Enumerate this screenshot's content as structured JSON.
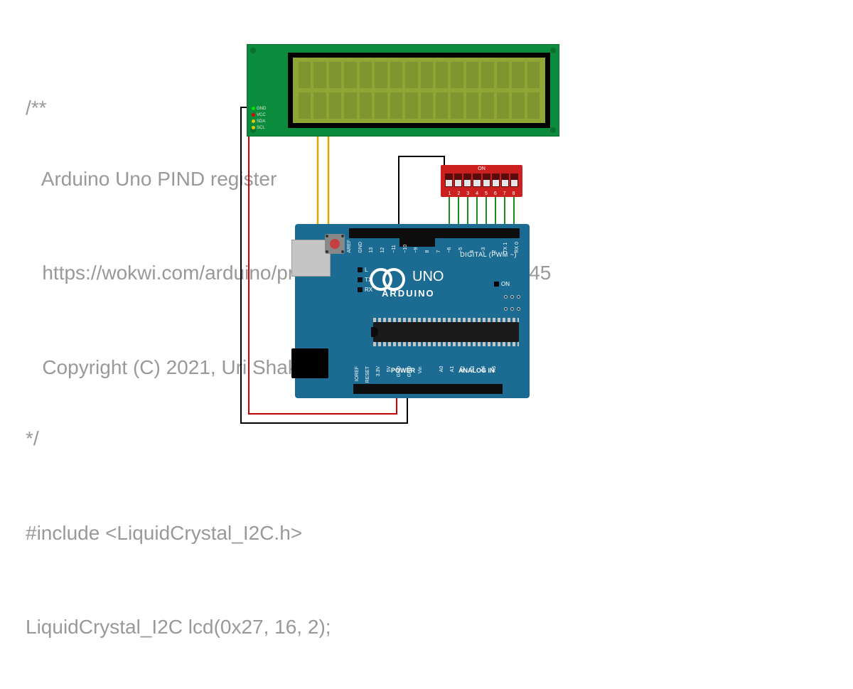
{
  "code": {
    "line1": "/**",
    "line2": "   Arduino Uno PIND register",
    "line3": "   https://wokwi.com/arduino/projects/314168546236039745",
    "line4": "   Copyright (C) 2021, Uri Shaked",
    "line5": "*/",
    "line6": "#include <LiquidCrystal_I2C.h>",
    "line7": "LiquidCrystal_I2C lcd(0x27, 16, 2);"
  },
  "lcd": {
    "cols": 16,
    "rows": 2,
    "pins": [
      "GND",
      "VCC",
      "SDA",
      "SCL"
    ]
  },
  "dip": {
    "label": "ON",
    "count": 8,
    "numbers": [
      "1",
      "2",
      "3",
      "4",
      "5",
      "6",
      "7",
      "8"
    ]
  },
  "arduino": {
    "brand": "ARDUINO",
    "model": "UNO",
    "digital_label": "DIGITAL (PWM ~)",
    "power_label": "POWER",
    "analog_label": "ANALOG IN",
    "on_label": "ON",
    "side_leds": [
      "L",
      "TX",
      "RX"
    ],
    "top_pins": [
      "AREF",
      "GND",
      "13",
      "12",
      "~11",
      "~10",
      "~9",
      "8",
      "7",
      "~6",
      "~5",
      "4",
      "~3",
      "2",
      "TX 1",
      "RX 0"
    ],
    "bot_pins": [
      "IOREF",
      "RESET",
      "3.3V",
      "5V",
      "GND",
      "GND",
      "Vin",
      "",
      "A0",
      "A1",
      "A2",
      "A3",
      "A4",
      "A5"
    ]
  },
  "wiring": {
    "colors": {
      "gnd": "#000000",
      "vcc": "#cc0000",
      "sda": "#d9a800",
      "scl": "#d9a800",
      "dip_gnd": "#000000",
      "dip_signal": "#1a8c1a"
    }
  }
}
